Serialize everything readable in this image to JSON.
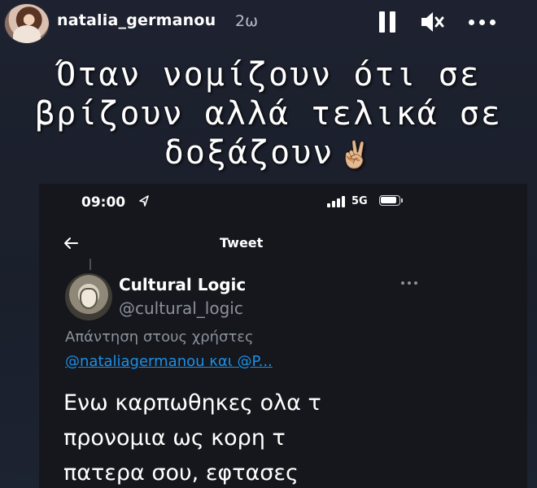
{
  "story": {
    "username": "natalia_germanou",
    "timestamp": "2ω",
    "controls": {
      "pause_icon": "pause-icon",
      "mute_icon": "volume-muted-icon",
      "more_icon": "more-horizontal-icon"
    },
    "caption_lines": [
      "Όταν νομίζουν ότι σε",
      "βρίζουν αλλά τελικά σε",
      "δοξάζουν"
    ],
    "caption_emoji": "✌🏼"
  },
  "screenshot": {
    "status": {
      "time": "09:00",
      "network": "5G",
      "icons": [
        "location-arrow-icon",
        "signal-bars-icon",
        "battery-icon"
      ]
    },
    "nav": {
      "title": "Tweet",
      "back_icon": "arrow-left-icon"
    },
    "tweet": {
      "display_name": "Cultural Logic",
      "handle": "@cultural_logic",
      "reply_to_label": "Απάντηση στους χρήστες",
      "mentions": "@nataliagermanou και @P...",
      "body_lines": [
        "Ενω καρπωθηκες ολα τ",
        "προνομια ως κορη τ",
        "πατερα σου, εφτασες"
      ]
    }
  },
  "colors": {
    "background": "#1b1f2a",
    "text": "#ffffff",
    "muted": "#8b919b",
    "link": "#1d8fe6"
  }
}
